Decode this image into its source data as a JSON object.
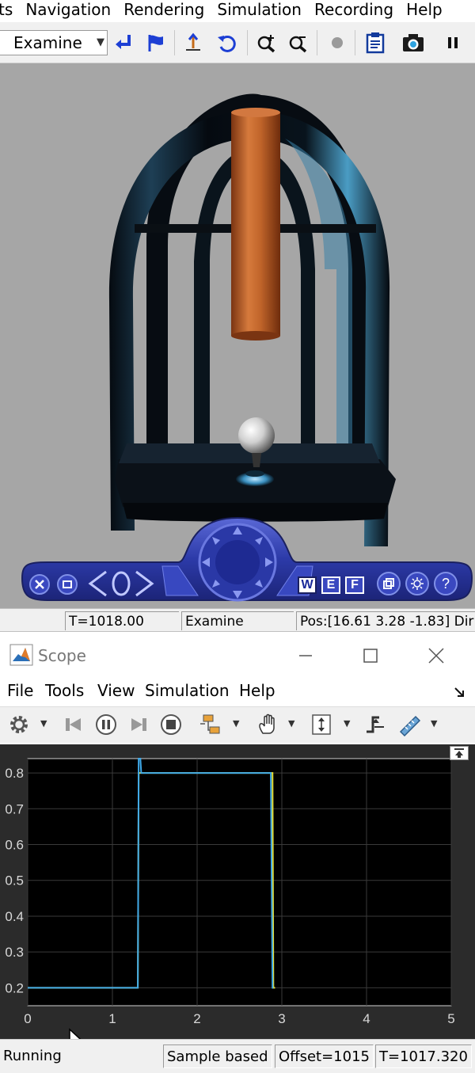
{
  "vr": {
    "menu": [
      "ts",
      "Navigation",
      "Rendering",
      "Simulation",
      "Recording",
      "Help"
    ],
    "nav_mode": "Examine",
    "nav_panel": {
      "w": "W",
      "e": "E",
      "f": "F"
    },
    "status": {
      "time": "T=1018.00",
      "mode": "Examine",
      "position": "Pos:[16.61 3.28 -1.83] Dir"
    }
  },
  "scope": {
    "title": "Scope",
    "menu": [
      "File",
      "Tools",
      "View",
      "Simulation",
      "Help"
    ],
    "status": {
      "state": "Running",
      "mode": "Sample based",
      "offset": "Offset=1015",
      "time": "T=1017.320"
    }
  },
  "colors": {
    "vr_background": "#a6a6a6",
    "scope_background": "#000000",
    "scope_frame": "#2b2b2b",
    "signal_blue": "#3fa9e9",
    "signal_yellow": "#e8e033",
    "cylinder": "#c0642a",
    "nav_panel": "#2c3aa8"
  },
  "chart_data": {
    "type": "line",
    "title": "",
    "xlabel": "",
    "ylabel": "",
    "xlim": [
      0,
      5
    ],
    "ylim": [
      0.15,
      0.84
    ],
    "xticks": [
      "0",
      "1",
      "2",
      "3",
      "4",
      "5"
    ],
    "yticks": [
      "0.2",
      "0.3",
      "0.4",
      "0.5",
      "0.6",
      "0.7",
      "0.8"
    ],
    "grid": true,
    "series": [
      {
        "color": "#e8e033",
        "x": [
          0,
          1.3,
          1.31,
          2.89,
          2.9,
          2.92
        ],
        "y": [
          0.2,
          0.2,
          0.8,
          0.8,
          0.2,
          0.2
        ]
      },
      {
        "color": "#3fa9e9",
        "x": [
          0,
          1.3,
          1.31,
          1.33,
          1.34,
          2.87,
          2.89,
          2.9
        ],
        "y": [
          0.2,
          0.2,
          0.84,
          0.84,
          0.8,
          0.8,
          0.2,
          0.2
        ]
      }
    ]
  }
}
